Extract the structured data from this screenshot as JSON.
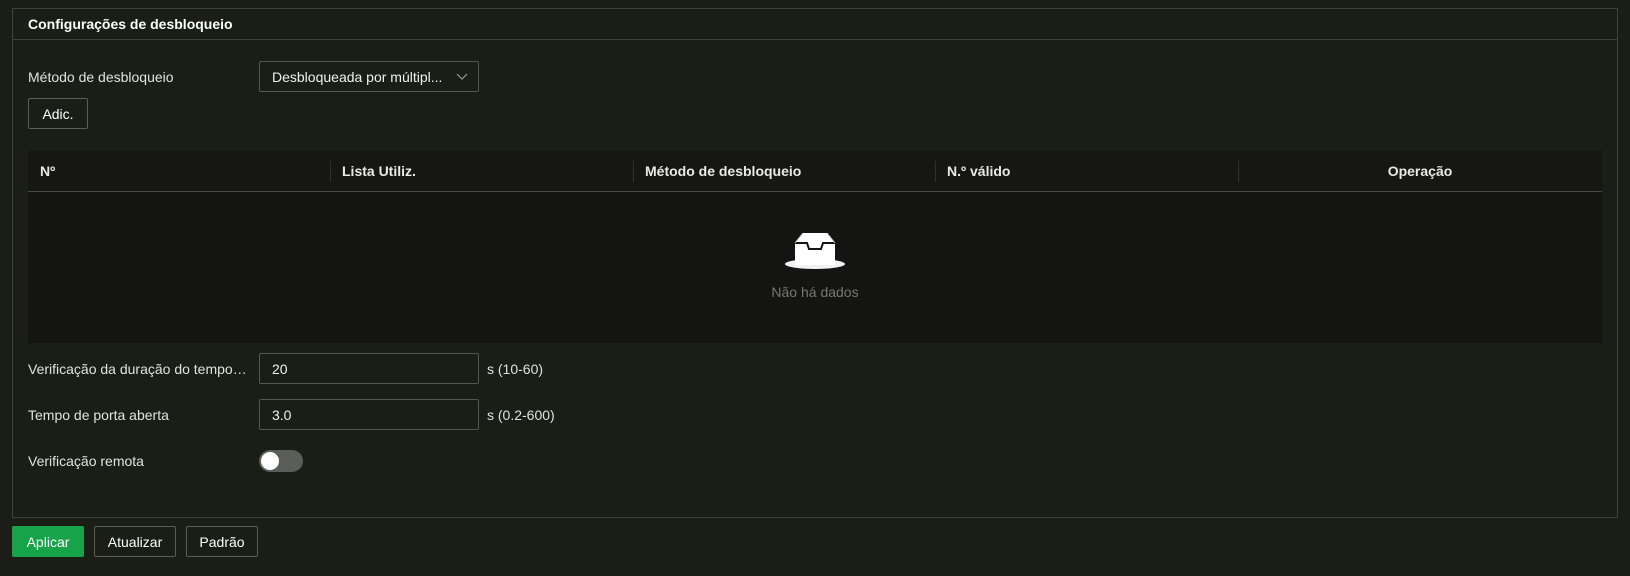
{
  "panel": {
    "title": "Configurações de desbloqueio"
  },
  "unlock_method": {
    "label": "Método de desbloqueio",
    "value": "Desbloqueada por múltipl..."
  },
  "add_button": "Adic.",
  "table": {
    "columns": [
      "Nº",
      "Lista Utiliz.",
      "Método de desbloqueio",
      "N.º válido",
      "Operação"
    ],
    "rows": [],
    "empty_text": "Não há dados"
  },
  "verification_timeout": {
    "label": "Verificação da duração do tempo li...",
    "value": "20",
    "hint": "s (10-60)"
  },
  "door_open_time": {
    "label": "Tempo de porta aberta",
    "value": "3.0",
    "hint": "s (0.2-600)"
  },
  "remote_verification": {
    "label": "Verificação remota",
    "enabled": false
  },
  "footer": {
    "apply": "Aplicar",
    "refresh": "Atualizar",
    "default": "Padrão"
  },
  "colors": {
    "background": "#1b1d17",
    "accent": "#16a34a",
    "border": "#3f423b"
  }
}
